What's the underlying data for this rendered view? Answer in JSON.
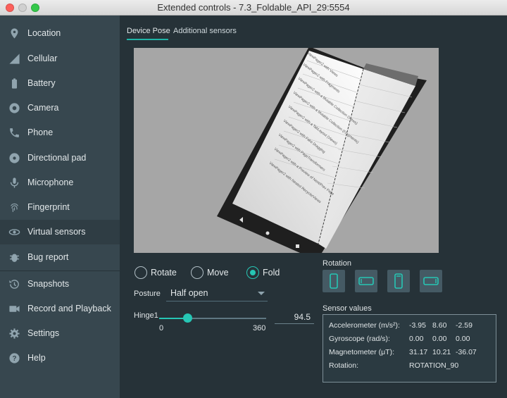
{
  "window": {
    "title": "Extended controls - 7.3_Foldable_API_29:5554"
  },
  "sidebar": {
    "items": [
      {
        "label": "Location",
        "icon": "location-pin-icon"
      },
      {
        "label": "Cellular",
        "icon": "signal-icon"
      },
      {
        "label": "Battery",
        "icon": "battery-icon"
      },
      {
        "label": "Camera",
        "icon": "camera-icon"
      },
      {
        "label": "Phone",
        "icon": "phone-icon"
      },
      {
        "label": "Directional pad",
        "icon": "dpad-icon"
      },
      {
        "label": "Microphone",
        "icon": "microphone-icon"
      },
      {
        "label": "Fingerprint",
        "icon": "fingerprint-icon"
      },
      {
        "label": "Virtual sensors",
        "icon": "virtual-sensors-icon"
      },
      {
        "label": "Bug report",
        "icon": "bug-icon"
      },
      {
        "label": "Snapshots",
        "icon": "history-icon"
      },
      {
        "label": "Record and Playback",
        "icon": "video-camera-icon"
      },
      {
        "label": "Settings",
        "icon": "gear-icon"
      },
      {
        "label": "Help",
        "icon": "help-icon"
      }
    ],
    "active": "Virtual sensors"
  },
  "tabs": [
    {
      "label": "Device Pose",
      "active": true
    },
    {
      "label": "Additional sensors",
      "active": false
    }
  ],
  "device_screen": {
    "list_items": [
      "ViewPager2 with Views",
      "ViewPager2 with Fragments",
      "ViewPager2 with a Mutable Collection (Views)",
      "ViewPager2 with a Mutable Collection (Fragments)",
      "ViewPager2 with a TabLayout (Views)",
      "ViewPager2 with Fake Dragging",
      "ViewPager2 with PageTransformers",
      "ViewPager2 with a Preview of Next/Prev Page",
      "ViewPager2 with Nested RecyclerViews"
    ]
  },
  "mode": {
    "options": [
      "Rotate",
      "Move",
      "Fold"
    ],
    "selected": "Fold"
  },
  "posture": {
    "label": "Posture",
    "value": "Half open"
  },
  "hinge": {
    "label": "Hinge1",
    "min": "0",
    "max": "360",
    "value": "94.5",
    "fraction": 0.2625
  },
  "rotation": {
    "label": "Rotation",
    "buttons": [
      "portrait-icon",
      "landscape-icon",
      "reverse-portrait-icon",
      "reverse-landscape-icon"
    ]
  },
  "sensor_values": {
    "label": "Sensor values",
    "accelerometer": {
      "label": "Accelerometer (m/s²):",
      "x": "-3.95",
      "y": "8.60",
      "z": "-2.59"
    },
    "gyroscope": {
      "label": "Gyroscope (rad/s):",
      "x": "0.00",
      "y": "0.00",
      "z": "0.00"
    },
    "magnetometer": {
      "label": "Magnetometer (μT):",
      "x": "31.17",
      "y": "10.21",
      "z": "-36.07"
    },
    "rotation": {
      "label": "Rotation:",
      "value": "ROTATION_90"
    }
  },
  "colors": {
    "accent": "#26c6b4",
    "sidebar": "#37474f",
    "background": "#263238"
  }
}
